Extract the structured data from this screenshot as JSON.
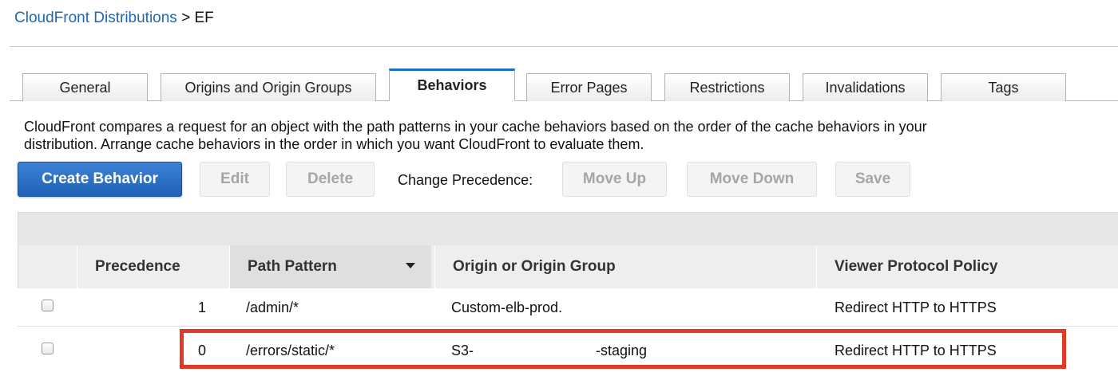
{
  "breadcrumb": {
    "link": "CloudFront Distributions",
    "separator": ">",
    "current": "EF"
  },
  "tabs": [
    {
      "label": "General"
    },
    {
      "label": "Origins and Origin Groups"
    },
    {
      "label": "Behaviors",
      "active": true
    },
    {
      "label": "Error Pages"
    },
    {
      "label": "Restrictions"
    },
    {
      "label": "Invalidations"
    },
    {
      "label": "Tags"
    }
  ],
  "description": "CloudFront compares a request for an object with the path patterns in your cache behaviors based on the order of the cache behaviors in your distribution. Arrange cache behaviors in the order in which you want CloudFront to evaluate them.",
  "toolbar": {
    "create_label": "Create Behavior",
    "edit_label": "Edit",
    "delete_label": "Delete",
    "change_precedence_label": "Change Precedence:",
    "move_up_label": "Move Up",
    "move_down_label": "Move Down",
    "save_label": "Save"
  },
  "table": {
    "columns": [
      "Precedence",
      "Path Pattern",
      "Origin or Origin Group",
      "Viewer Protocol Policy"
    ],
    "sorted_column": "Path Pattern",
    "rows": [
      {
        "precedence": "1",
        "path_pattern": "/admin/*",
        "origin_prefix": "Custom-elb-prod.",
        "origin_suffix": "",
        "viewer_protocol_policy": "Redirect HTTP to HTTPS"
      },
      {
        "precedence": "0",
        "path_pattern": "/errors/static/*",
        "origin_prefix": "S3-",
        "origin_suffix": "-staging",
        "viewer_protocol_policy": "Redirect HTTP to HTTPS"
      }
    ]
  },
  "colors": {
    "link": "#1f67b0",
    "primary_button": "#1f62b6",
    "active_tab_border": "#1a6ec7",
    "highlight": "#e03a24"
  }
}
